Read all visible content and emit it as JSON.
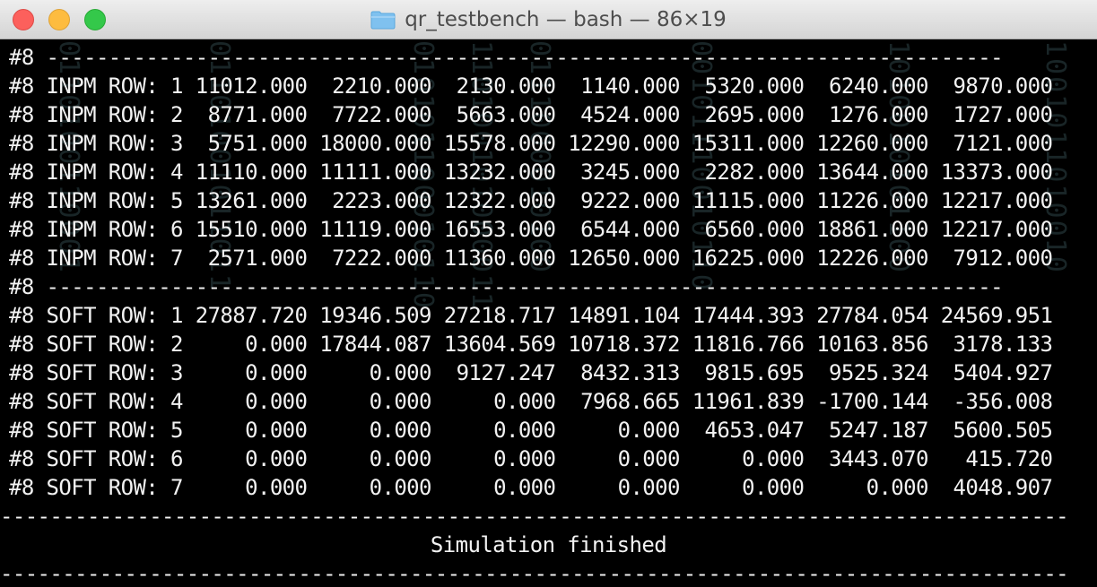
{
  "window": {
    "title": "qr_testbench — bash — 86×19"
  },
  "terminal": {
    "lines": [
      "#8 -----------------------------------------------------------------------------",
      "#8 INPM ROW: 1 11012.000  2210.000  2130.000  1140.000  5320.000  6240.000  9870.000",
      "#8 INPM ROW: 2  8771.000  7722.000  5663.000  4524.000  2695.000  1276.000  1727.000",
      "#8 INPM ROW: 3  5751.000 18000.000 15578.000 12290.000 15311.000 12260.000  7121.000",
      "#8 INPM ROW: 4 11110.000 11111.000 13232.000  3245.000  2282.000 13644.000 13373.000",
      "#8 INPM ROW: 5 13261.000  2223.000 12322.000  9222.000 11115.000 11226.000 12217.000",
      "#8 INPM ROW: 6 15510.000 11119.000 16553.000  6544.000  6560.000 18861.000 12217.000",
      "#8 INPM ROW: 7  2571.000  7222.000 11360.000 12650.000 16225.000 12226.000  7912.000",
      "#8 -----------------------------------------------------------------------------",
      "#8 SOFT ROW: 1 27887.720 19346.509 27218.717 14891.104 17444.393 27784.054 24569.951",
      "#8 SOFT ROW: 2     0.000 17844.087 13604.569 10718.372 11816.766 10163.856  3178.133",
      "#8 SOFT ROW: 3     0.000     0.000  9127.247  8432.313  9815.695  9525.324  5404.927",
      "#8 SOFT ROW: 4     0.000     0.000     0.000  7968.665 11961.839 -1700.144  -356.008",
      "#8 SOFT ROW: 5     0.000     0.000     0.000     0.000  4653.047  5247.187  5600.505",
      "#8 SOFT ROW: 6     0.000     0.000     0.000     0.000     0.000  3443.070   415.720",
      "#8 SOFT ROW: 7     0.000     0.000     0.000     0.000     0.000     0.000  4048.907"
    ],
    "rule": "--------------------------------------------------------------------------------------",
    "finished_text": "Simulation finished"
  },
  "icons": {
    "folder": "folder-icon"
  },
  "colors": {
    "traffic_close": "#fc605c",
    "traffic_minimize": "#fdbc40",
    "traffic_zoom": "#34c84a",
    "terminal_bg": "#000000",
    "terminal_fg": "#f2f2f2"
  }
}
